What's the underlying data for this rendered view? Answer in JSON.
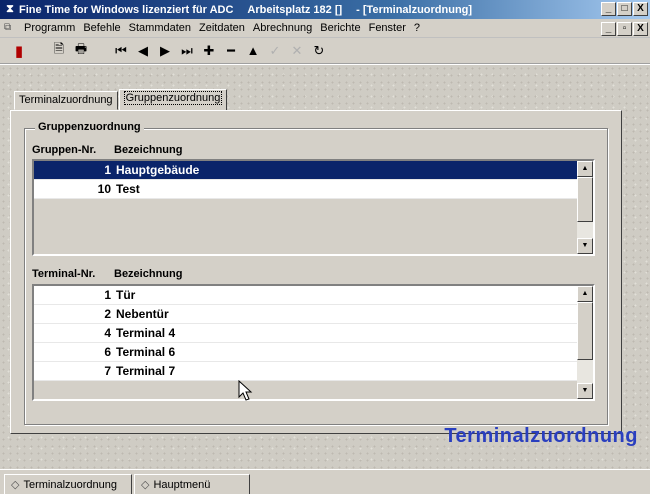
{
  "window": {
    "icon": "hourglass-icon",
    "title_app": "Fine Time for Windows lizenziert für ADC",
    "title_workplace": "Arbeitsplatz 182 []",
    "title_form": "- [Terminalzuordnung]",
    "buttons": [
      "_",
      "□",
      "X"
    ]
  },
  "menubar": {
    "items": [
      "Programm",
      "Befehle",
      "Stammdaten",
      "Zeitdaten",
      "Abrechnung",
      "Berichte",
      "Fenster",
      "?"
    ],
    "mdi_buttons": [
      "_",
      "▫",
      "X"
    ]
  },
  "toolbar": {
    "buttons": [
      {
        "icon": "exit-door-icon",
        "glyph": "▮"
      },
      {
        "icon": "preview-icon",
        "glyph": "🗎"
      },
      {
        "icon": "print-icon",
        "glyph": "🖶"
      },
      {
        "icon": "first-record-icon",
        "glyph": "⏮"
      },
      {
        "icon": "prev-record-icon",
        "glyph": "◀"
      },
      {
        "icon": "next-record-icon",
        "glyph": "▶"
      },
      {
        "icon": "last-record-icon",
        "glyph": "⏭"
      },
      {
        "icon": "add-icon",
        "glyph": "✚"
      },
      {
        "icon": "delete-icon",
        "glyph": "━"
      },
      {
        "icon": "up-icon",
        "glyph": "▲"
      },
      {
        "icon": "confirm-icon",
        "glyph": "✓"
      },
      {
        "icon": "cancel-icon",
        "glyph": "✕"
      },
      {
        "icon": "refresh-icon",
        "glyph": "↻"
      }
    ]
  },
  "tabs": {
    "terminal": "Terminalzuordnung",
    "gruppen": "Gruppenzuordnung"
  },
  "group": {
    "title": "Gruppenzuordnung",
    "col_nr": "Gruppen-Nr.",
    "col_name": "Bezeichnung",
    "rows": [
      {
        "nr": "1",
        "name": "Hauptgebäude",
        "selected": true
      },
      {
        "nr": "10",
        "name": "Test",
        "selected": false
      }
    ]
  },
  "terminals": {
    "col_nr": "Terminal-Nr.",
    "col_name": "Bezeichnung",
    "rows": [
      {
        "nr": "1",
        "name": "Tür"
      },
      {
        "nr": "2",
        "name": "Nebentür"
      },
      {
        "nr": "4",
        "name": "Terminal 4"
      },
      {
        "nr": "6",
        "name": "Terminal 6"
      },
      {
        "nr": "7",
        "name": "Terminal 7"
      }
    ]
  },
  "form_caption": "Terminalzuordnung",
  "taskbar": {
    "items": [
      {
        "label": "Terminalzuordnung",
        "icon": "form-icon"
      },
      {
        "label": "Hauptmenü",
        "icon": "form-icon"
      }
    ]
  }
}
